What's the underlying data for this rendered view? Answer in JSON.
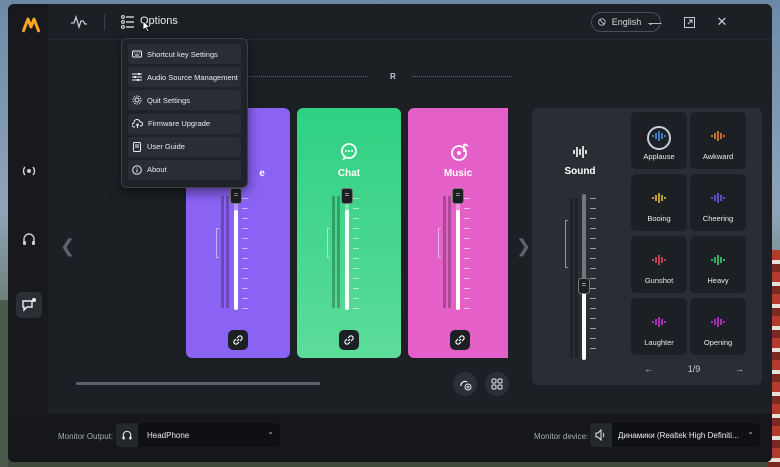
{
  "header": {
    "options_label": "Options",
    "language": "English"
  },
  "menu": {
    "items": [
      {
        "label": "Shortcut key Settings",
        "icon": "keyboard-icon"
      },
      {
        "label": "Audio Source Management",
        "icon": "sliders-icon"
      },
      {
        "label": "Quit Settings",
        "icon": "gear-icon"
      },
      {
        "label": "Firmware Upgrade",
        "icon": "cloud-upgrade-icon"
      },
      {
        "label": "User Guide",
        "icon": "book-icon"
      },
      {
        "label": "About",
        "icon": "info-icon"
      }
    ]
  },
  "mixer": {
    "channel_label": "R",
    "channels": [
      {
        "name": "Game",
        "visible_name": "e",
        "color": "#8a63f5",
        "level": 0.86
      },
      {
        "name": "Chat",
        "visible_name": "Chat",
        "color": "#2fd081",
        "level": 0.86
      },
      {
        "name": "Music",
        "visible_name": "Music",
        "color": "#e45fc8",
        "level": 0.86
      }
    ]
  },
  "sound": {
    "title": "Sound",
    "level": 0.55,
    "pads": [
      {
        "name": "Applause",
        "color": "#4a90e2",
        "selected": true
      },
      {
        "name": "Awkward",
        "color": "#e8823a"
      },
      {
        "name": "Booing",
        "color": "#e2c23a"
      },
      {
        "name": "Cheering",
        "color": "#6c5ce7"
      },
      {
        "name": "Gunshot",
        "color": "#e24a5a"
      },
      {
        "name": "Heavy",
        "color": "#3ad27a"
      },
      {
        "name": "Laughter",
        "color": "#c23ad2"
      },
      {
        "name": "Opening",
        "color": "#c23ad2"
      }
    ],
    "page": "1/9"
  },
  "bottom": {
    "monitor_output_label": "Monitor Output:",
    "monitor_output_value": "HeadPhone",
    "monitor_device_label": "Monitor device:",
    "monitor_device_value": "Динамики (Realtek High Definiti..."
  }
}
